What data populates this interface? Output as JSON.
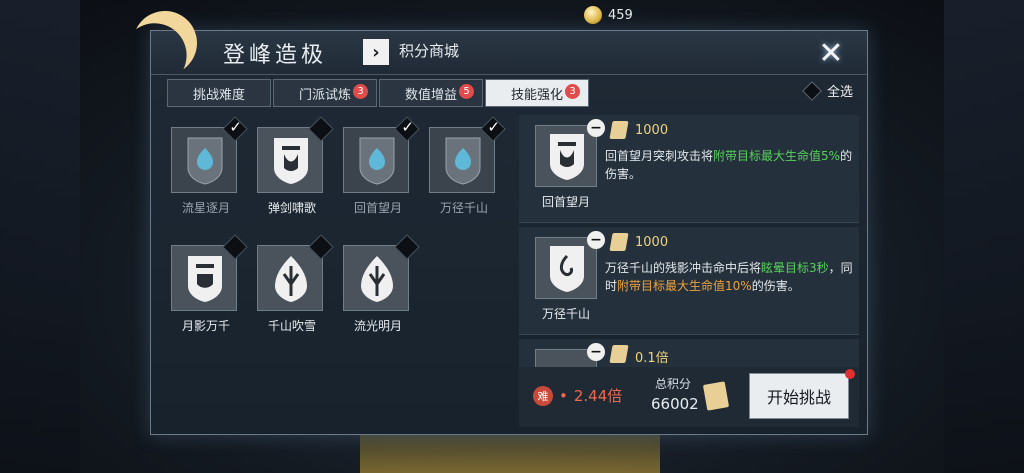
{
  "currency": {
    "value": "459"
  },
  "header": {
    "title": "登峰造极",
    "shop_label": "积分商城",
    "chevron": "›",
    "close": "✕"
  },
  "tabs": [
    {
      "label": "挑战难度",
      "badge": ""
    },
    {
      "label": "门派试炼",
      "badge": "3"
    },
    {
      "label": "数值增益",
      "badge": "5"
    },
    {
      "label": "技能强化",
      "badge": "3"
    }
  ],
  "active_tab_index": 3,
  "select_all_label": "全选",
  "skills": [
    {
      "name": "流星逐月",
      "selected": true,
      "icon": "shield-emblem-icon"
    },
    {
      "name": "弹剑啸歌",
      "selected": false,
      "icon": "banner-emblem-icon"
    },
    {
      "name": "回首望月",
      "selected": true,
      "icon": "shield-emblem-icon"
    },
    {
      "name": "万径千山",
      "selected": true,
      "icon": "shield-emblem-icon"
    },
    {
      "name": "月影万千",
      "selected": false,
      "icon": "banner-emblem-icon"
    },
    {
      "name": "千山吹雪",
      "selected": false,
      "icon": "flame-emblem-icon"
    },
    {
      "name": "流光明月",
      "selected": false,
      "icon": "flame-emblem-icon"
    }
  ],
  "list": [
    {
      "name": "回首望月",
      "cost": "1000",
      "desc_prefix": "回首望月突刺攻击将",
      "desc_green": "附带目标最大生命值5%",
      "desc_suffix": "的伤害。"
    },
    {
      "name": "万径千山",
      "cost": "1000",
      "desc_prefix": "万径千山的残影冲击命中后将",
      "desc_green": "眩晕目标3秒",
      "desc_mid": "，同时",
      "desc_orange": "附带目标最大生命值10%",
      "desc_suffix": "的伤害。"
    },
    {
      "name": "",
      "cost": "0.1倍"
    }
  ],
  "footer": {
    "difficulty_seal": "难",
    "difficulty": "2.44倍",
    "score_label": "总积分",
    "score": "66002",
    "start_label": "开始挑战"
  },
  "colors": {
    "green": "#57d15c",
    "orange": "#f0a23c",
    "badge": "#e24b4b",
    "cost": "#f0d27a"
  }
}
